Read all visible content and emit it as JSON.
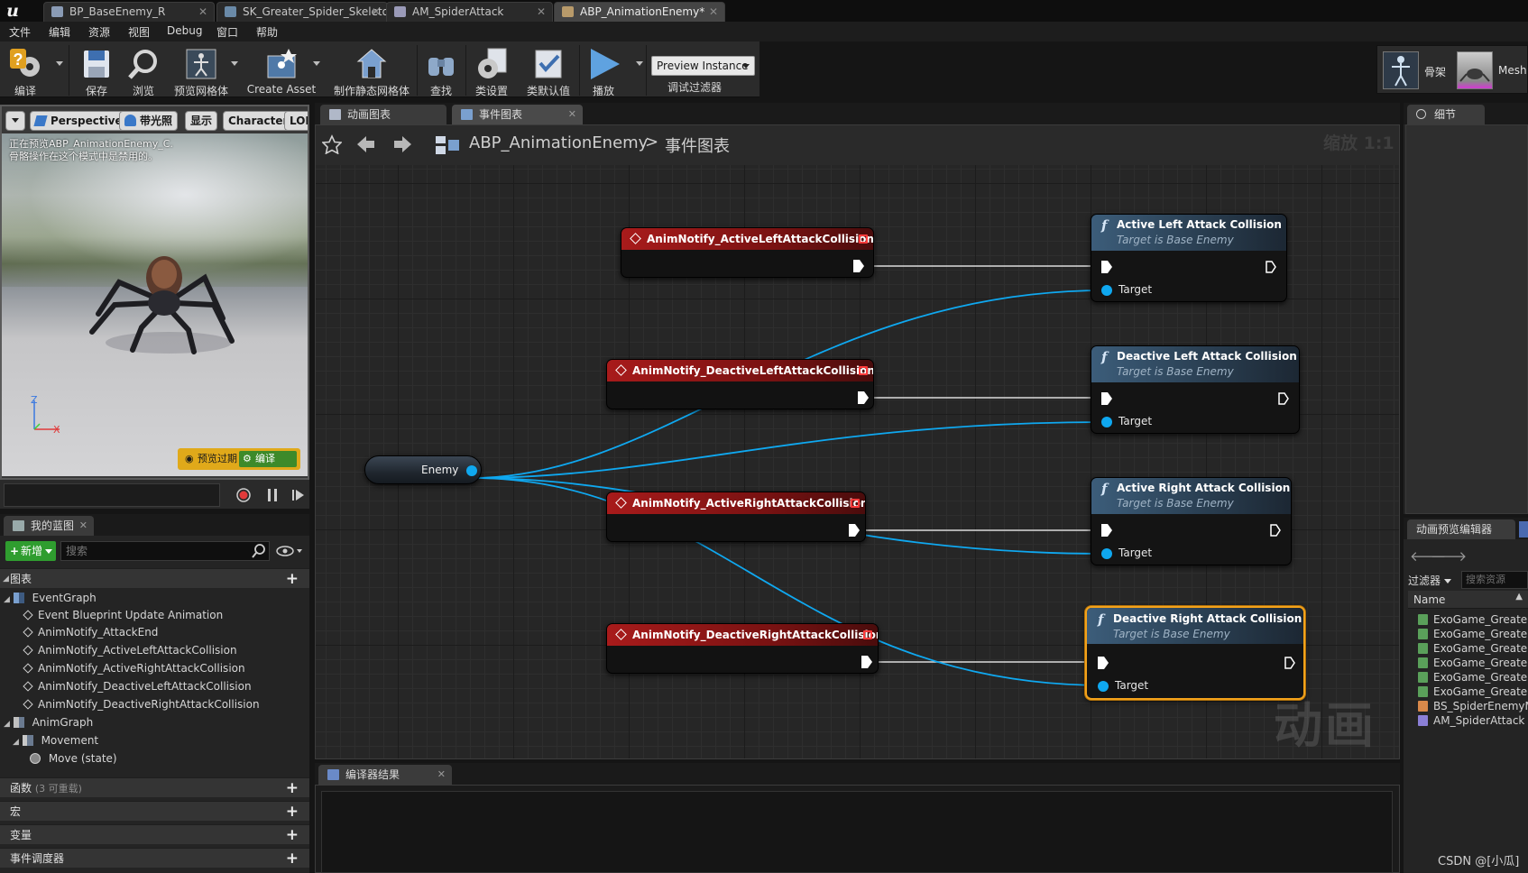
{
  "document_tabs": [
    {
      "label": "BP_BaseEnemy_R",
      "active": false
    },
    {
      "label": "SK_Greater_Spider_Skeleto",
      "active": false
    },
    {
      "label": "AM_SpiderAttack",
      "active": false
    },
    {
      "label": "ABP_AnimationEnemy*",
      "active": true
    }
  ],
  "menu": [
    "文件",
    "编辑",
    "资源",
    "视图",
    "Debug",
    "窗口",
    "帮助"
  ],
  "toolbar": {
    "compile": "编译",
    "save": "保存",
    "browse": "浏览",
    "preview_mesh": "预览网格体",
    "create_asset": "Create Asset",
    "make_static_mesh": "制作静态网格体",
    "find": "查找",
    "class_settings": "类设置",
    "class_defaults": "类默认值",
    "play": "播放",
    "preview_instance": "Preview Instance",
    "debug_filter": "调试过滤器"
  },
  "modes": {
    "skeleton": "骨架",
    "mesh": "Mesh"
  },
  "viewport": {
    "perspective": "Perspective",
    "lit": "带光照",
    "show": "显示",
    "character": "Character",
    "lod": "LOD",
    "info_line1": "正在预览ABP_AnimationEnemy_C.",
    "info_line2": "骨骼操作在这个模式中是禁用的。",
    "axis_z": "Z",
    "axis_x": "X",
    "badge_preview": "预览过期",
    "badge_compile": "编译"
  },
  "my_blueprint": {
    "tab": "我的蓝图",
    "add_new": "新增",
    "search_placeholder": "搜索",
    "graphs_header": "图表",
    "tree": [
      {
        "label": "EventGraph",
        "level": 0,
        "kind": "graph"
      },
      {
        "label": "Event Blueprint Update Animation",
        "level": 1,
        "kind": "event"
      },
      {
        "label": "AnimNotify_AttackEnd",
        "level": 1,
        "kind": "event"
      },
      {
        "label": "AnimNotify_ActiveLeftAttackCollision",
        "level": 1,
        "kind": "event"
      },
      {
        "label": "AnimNotify_ActiveRightAttackCollision",
        "level": 1,
        "kind": "event"
      },
      {
        "label": "AnimNotify_DeactiveLeftAttackCollision",
        "level": 1,
        "kind": "event"
      },
      {
        "label": "AnimNotify_DeactiveRightAttackCollision",
        "level": 1,
        "kind": "event"
      },
      {
        "label": "AnimGraph",
        "level": 0,
        "kind": "graph"
      },
      {
        "label": "Movement",
        "level": 1,
        "kind": "statemachine"
      },
      {
        "label": "Move (state)",
        "level": 2,
        "kind": "state"
      }
    ],
    "functions_header": "函数",
    "functions_sub": "(3 可重载)",
    "macros_header": "宏",
    "variables_header": "变量",
    "dispatchers_header": "事件调度器"
  },
  "graph": {
    "tabs": [
      {
        "label": "动画图表",
        "active": false
      },
      {
        "label": "事件图表",
        "active": true
      }
    ],
    "breadcrumb_root": "ABP_AnimationEnemy",
    "breadcrumb_sep": ">",
    "breadcrumb_leaf": "事件图表",
    "zoom": "缩放 1:1",
    "watermark": "动画",
    "enemy_variable": "Enemy",
    "events": [
      {
        "label": "AnimNotify_ActiveLeftAttackCollision"
      },
      {
        "label": "AnimNotify_DeactiveLeftAttackCollision"
      },
      {
        "label": "AnimNotify_ActiveRightAttackCollision"
      },
      {
        "label": "AnimNotify_DeactiveRightAttackCollision"
      }
    ],
    "functions": [
      {
        "title": "Active Left Attack Collision",
        "subtitle": "Target is Base Enemy",
        "pin": "Target",
        "selected": false
      },
      {
        "title": "Deactive Left Attack Collision",
        "subtitle": "Target is Base Enemy",
        "pin": "Target",
        "selected": false
      },
      {
        "title": "Active Right Attack Collision",
        "subtitle": "Target is Base Enemy",
        "pin": "Target",
        "selected": false
      },
      {
        "title": "Deactive Right Attack Collision",
        "subtitle": "Target is Base Enemy",
        "pin": "Target",
        "selected": true
      }
    ],
    "function_glyph": "f"
  },
  "compiler": {
    "tab": "编译器结果"
  },
  "details": {
    "tab": "细节"
  },
  "asset_browser": {
    "tab": "动画预览编辑器",
    "filter": "过滤器",
    "search_placeholder": "搜索资源",
    "column": "Name",
    "items": [
      {
        "label": "ExoGame_Greater_S",
        "color": "#5aa05a"
      },
      {
        "label": "ExoGame_Greater_S",
        "color": "#5aa05a"
      },
      {
        "label": "ExoGame_Greater_S",
        "color": "#5aa05a"
      },
      {
        "label": "ExoGame_Greater_S",
        "color": "#5aa05a"
      },
      {
        "label": "ExoGame_Greater_S",
        "color": "#5aa05a"
      },
      {
        "label": "ExoGame_Greater_S",
        "color": "#5aa05a"
      },
      {
        "label": "BS_SpiderEnemyMo",
        "color": "#d9894a"
      },
      {
        "label": "AM_SpiderAttack",
        "color": "#8b7fd6"
      }
    ]
  },
  "watermark_source": "CSDN @[小瓜]",
  "colors": {
    "event_header": "#a81b1b",
    "function_header": "#3c5d7a",
    "object_pin": "#0fa8f0",
    "selection": "#f3a21b"
  }
}
